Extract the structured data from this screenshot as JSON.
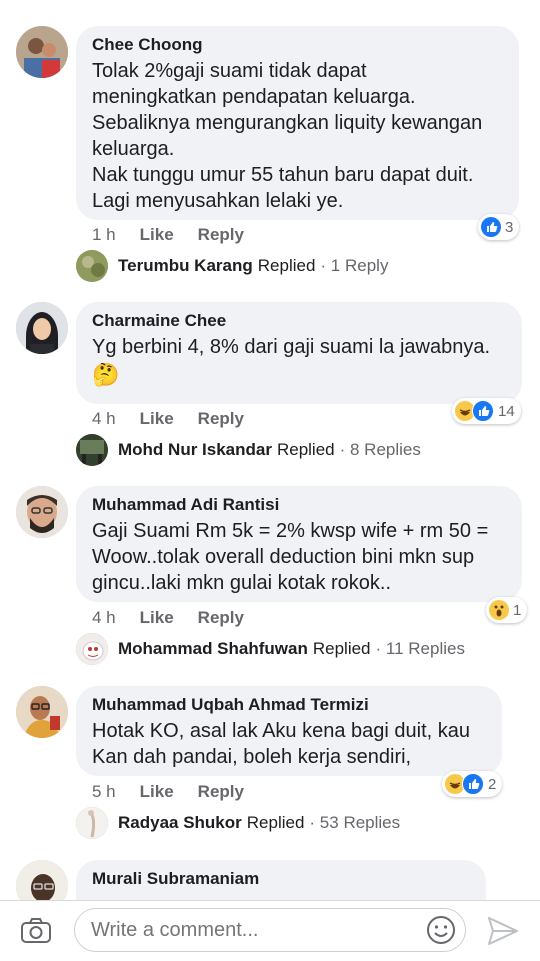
{
  "comments": [
    {
      "author": "Chee Choong",
      "text": "Tolak 2%gaji suami tidak dapat\nmeningkatkan pendapatan keluarga.\nSebaliknya mengurangkan liquity kewangan\nkeluarga.\nNak tunggu umur 55 tahun baru dapat duit.\nLagi menyusahkan lelaki ye.",
      "time": "1 h",
      "like": "Like",
      "reply": "Reply",
      "reaction_count": "3",
      "replies": {
        "name": "Terumbu Karang",
        "replied": "Replied",
        "count": "· 1 Reply"
      }
    },
    {
      "author": "Charmaine Chee",
      "text": "Yg berbini 4, 8% dari gaji suami la jawabnya.",
      "emoji": "🤔",
      "time": "4 h",
      "like": "Like",
      "reply": "Reply",
      "reaction_count": "14",
      "replies": {
        "name": "Mohd Nur Iskandar",
        "replied": "Replied",
        "count": "· 8 Replies"
      }
    },
    {
      "author": "Muhammad Adi Rantisi",
      "text": "Gaji Suami Rm 5k = 2% kwsp wife + rm 50 =\nWoow..tolak overall deduction bini mkn sup\ngincu..laki mkn gulai kotak rokok..",
      "time": "4 h",
      "like": "Like",
      "reply": "Reply",
      "reaction_count": "1",
      "replies": {
        "name": "Mohammad Shahfuwan",
        "replied": "Replied",
        "count": "· 11 Replies"
      }
    },
    {
      "author": "Muhammad Uqbah Ahmad Termizi",
      "text": "Hotak KO, asal lak Aku kena bagi duit, kau\nKan dah pandai, boleh kerja sendiri,",
      "time": "5 h",
      "like": "Like",
      "reply": "Reply",
      "reaction_count": "2",
      "replies": {
        "name": "Radyaa Shukor",
        "replied": "Replied",
        "count": "· 53 Replies"
      }
    },
    {
      "author": "Murali Subramaniam"
    }
  ],
  "composer": {
    "placeholder": "Write a comment...",
    "icons": [
      "camera-icon",
      "emoji-icon",
      "send-icon"
    ]
  },
  "colors": {
    "like_blue": "#1877f2",
    "bubble_bg": "#f0f2f5",
    "meta_gray": "#65676b"
  }
}
